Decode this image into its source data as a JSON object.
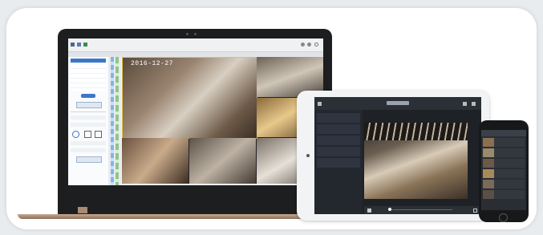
{
  "live_view": {
    "timestamp": "2016-12-27"
  }
}
